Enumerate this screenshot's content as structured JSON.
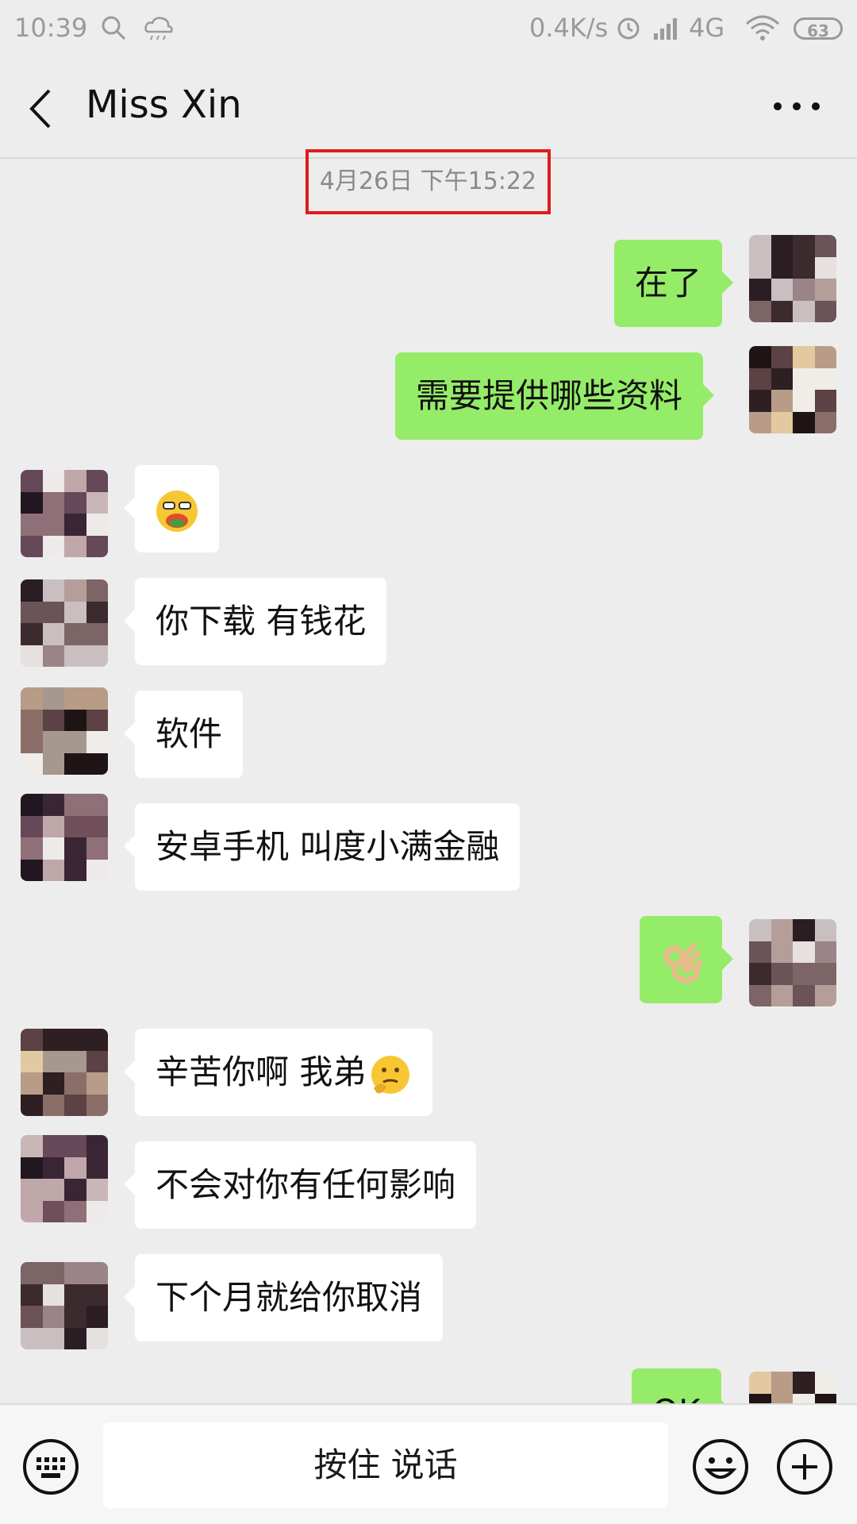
{
  "status_bar": {
    "time": "10:39",
    "net_speed": "0.4K/s",
    "network": "4G",
    "battery": "63"
  },
  "header": {
    "title": "Miss Xin"
  },
  "timestamp": "4月26日 下午15:22",
  "messages": [
    {
      "side": "out",
      "text": "在了"
    },
    {
      "side": "out",
      "text": "需要提供哪些资料"
    },
    {
      "side": "in",
      "text": "",
      "emoji": "grinning-emoji"
    },
    {
      "side": "in",
      "text": "你下载 有钱花"
    },
    {
      "side": "in",
      "text": "软件"
    },
    {
      "side": "in",
      "text": "安卓手机 叫度小满金融"
    },
    {
      "side": "out",
      "text": "",
      "emoji": "ok-hand-emoji"
    },
    {
      "side": "in",
      "text": "辛苦你啊 我弟",
      "emoji": "thinking-emoji"
    },
    {
      "side": "in",
      "text": "不会对你有任何影响"
    },
    {
      "side": "in",
      "text": "下个月就给你取消"
    },
    {
      "side": "out",
      "text": "OK"
    }
  ],
  "input_bar": {
    "voice_label": "按住 说话"
  },
  "colors": {
    "outgoing_bubble": "#95ec69",
    "incoming_bubble": "#ffffff",
    "background": "#ededed",
    "highlight_box": "#e11b1b"
  },
  "icons": [
    "back-arrow-icon",
    "more-icon",
    "keyboard-icon",
    "emoji-icon",
    "plus-icon",
    "search-icon",
    "cloud-icon",
    "alarm-icon",
    "signal-icon",
    "wifi-icon"
  ]
}
